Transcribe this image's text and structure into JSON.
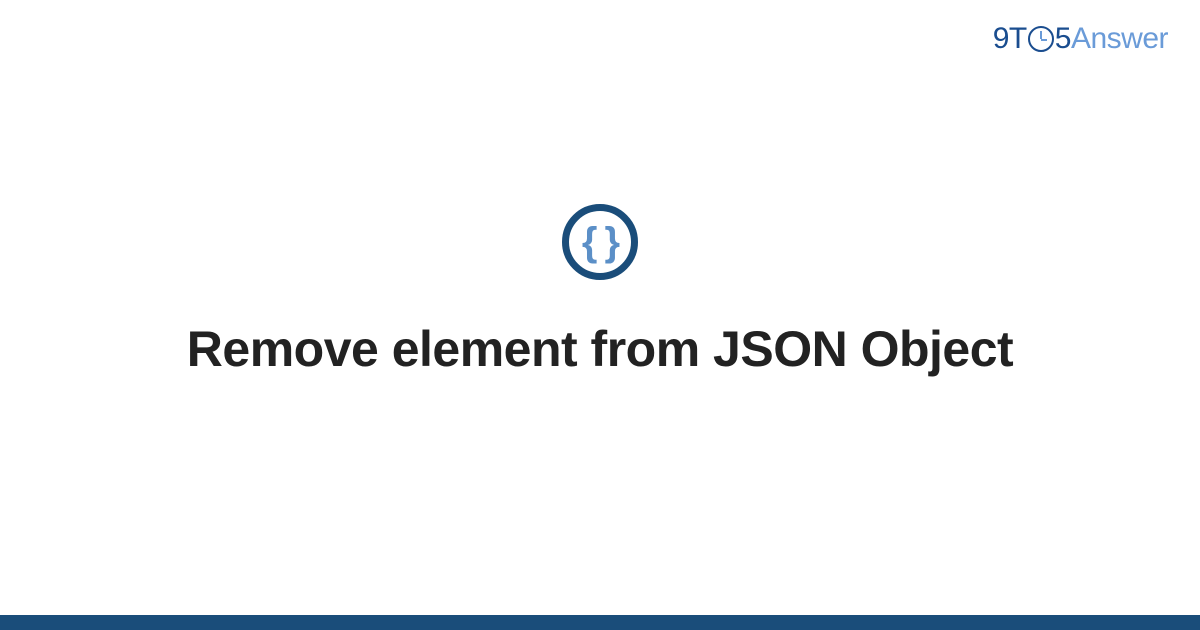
{
  "logo": {
    "prefix": "9T",
    "middle_icon": "clock-icon",
    "suffix": "5",
    "word": "Answer"
  },
  "icon": {
    "type": "json-braces",
    "glyph": "{ }"
  },
  "title": "Remove element from JSON Object",
  "colors": {
    "brand_dark": "#1a4d7a",
    "brand_light": "#6a9bd8",
    "text": "#222222"
  }
}
